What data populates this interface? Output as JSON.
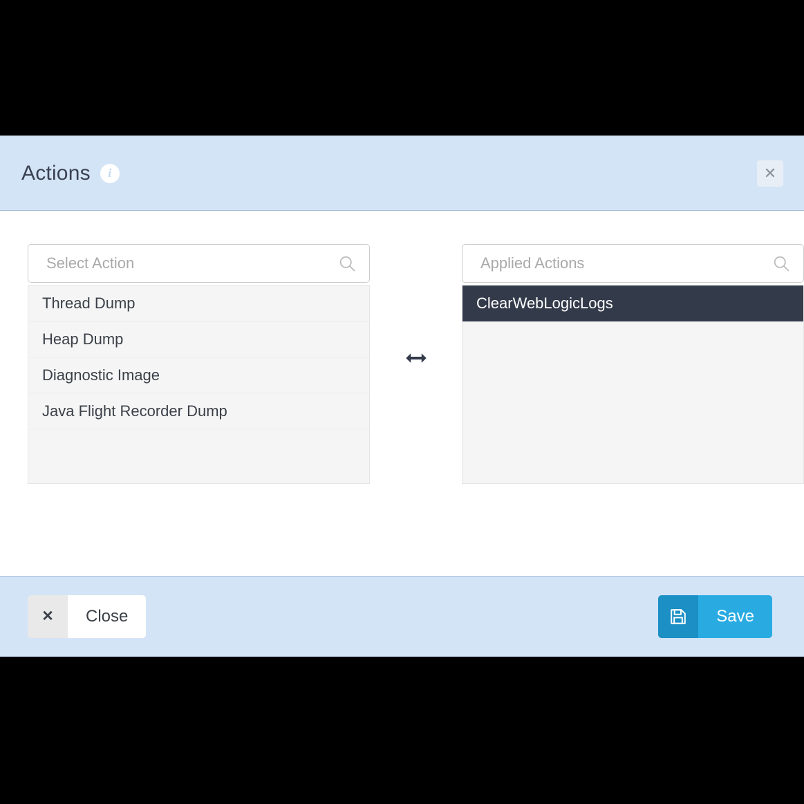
{
  "header": {
    "title": "Actions",
    "info_icon": "info-icon",
    "close_icon": "close-icon",
    "bg_color": "#D4E4F7"
  },
  "available": {
    "search": {
      "placeholder": "Select Action",
      "value": "",
      "icon": "search-icon"
    },
    "items": [
      {
        "label": "Thread Dump",
        "selected": false
      },
      {
        "label": "Heap Dump",
        "selected": false
      },
      {
        "label": "Diagnostic Image",
        "selected": false
      },
      {
        "label": "Java Flight Recorder Dump",
        "selected": false
      }
    ]
  },
  "transfer": {
    "icon": "double-arrow-icon"
  },
  "applied": {
    "search": {
      "placeholder": "Applied Actions",
      "value": "",
      "icon": "search-icon"
    },
    "items": [
      {
        "label": "ClearWebLogicLogs",
        "selected": true
      }
    ]
  },
  "footer": {
    "close_label": "Close",
    "close_icon": "close-x-icon",
    "save_label": "Save",
    "save_icon": "floppy-disk-icon",
    "accent_color": "#29ABE2",
    "accent_dark_color": "#1C8FC4",
    "selected_color": "#333A4A"
  }
}
